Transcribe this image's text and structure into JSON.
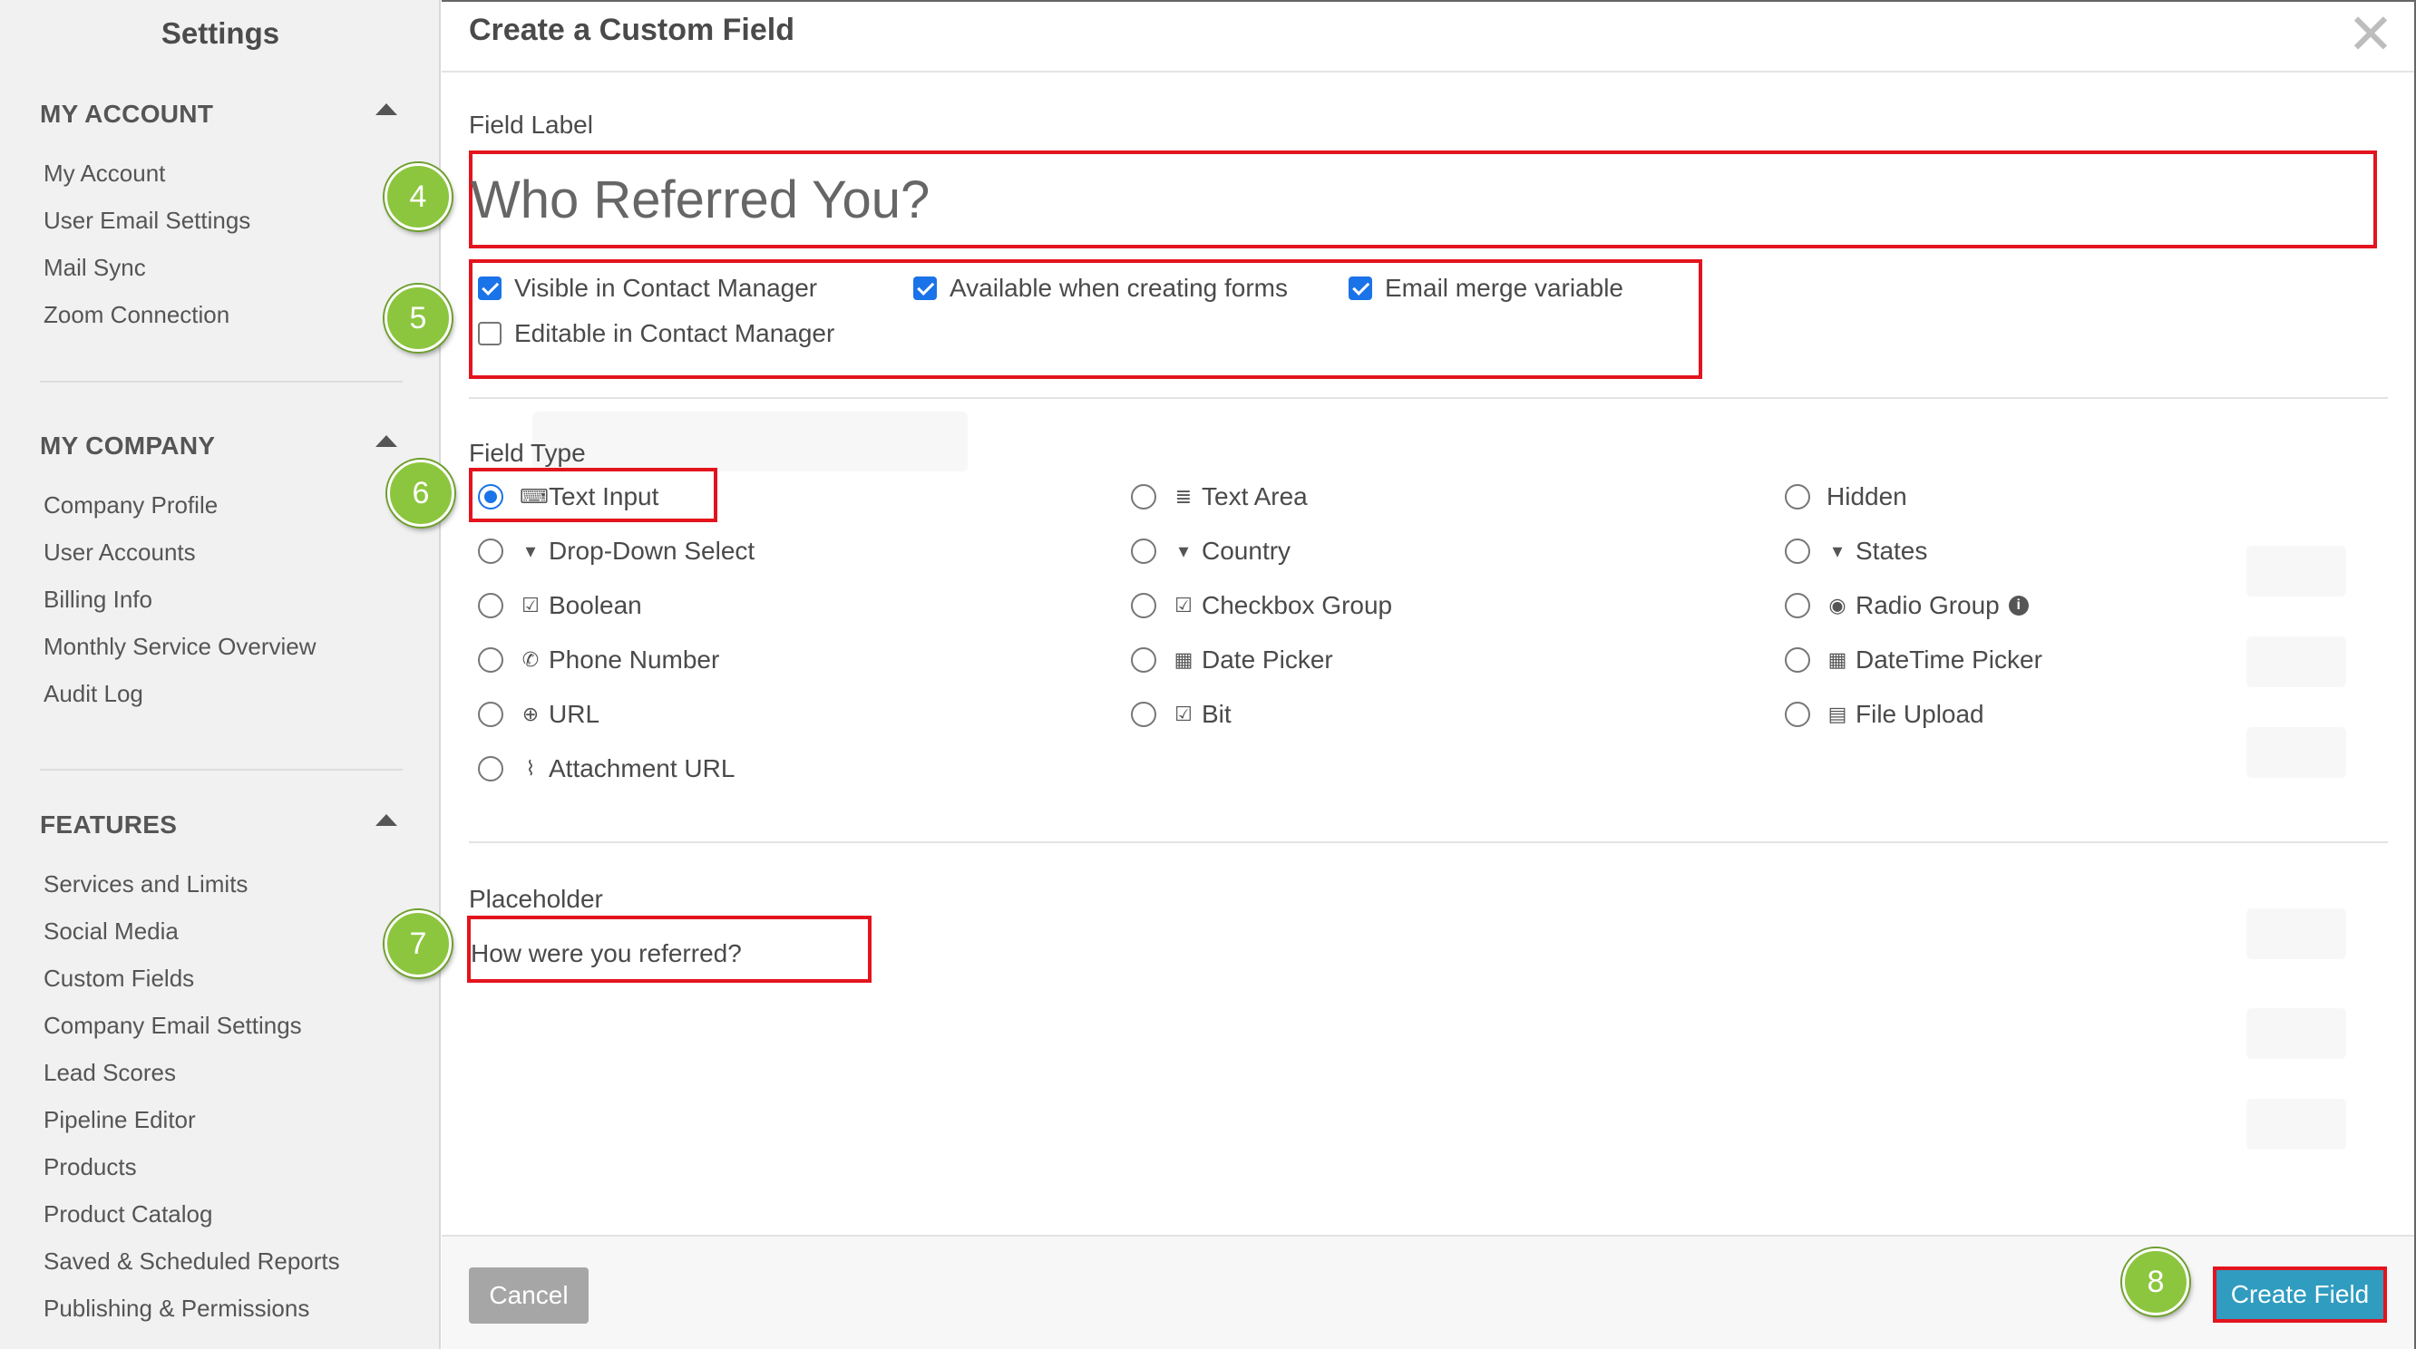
{
  "sidebar": {
    "title": "Settings",
    "sections": [
      {
        "title": "MY ACCOUNT",
        "items": [
          "My Account",
          "User Email Settings",
          "Mail Sync",
          "Zoom Connection"
        ]
      },
      {
        "title": "MY COMPANY",
        "items": [
          "Company Profile",
          "User Accounts",
          "Billing Info",
          "Monthly Service Overview",
          "Audit Log"
        ]
      },
      {
        "title": "FEATURES",
        "items": [
          "Services and Limits",
          "Social Media",
          "Custom Fields",
          "Company Email Settings",
          "Lead Scores",
          "Pipeline Editor",
          "Products",
          "Product Catalog",
          "Saved & Scheduled Reports",
          "Publishing & Permissions"
        ]
      }
    ]
  },
  "modal": {
    "title": "Create a Custom Field",
    "close_label": "✕",
    "field_label": {
      "label": "Field Label",
      "value": "Who Referred You?"
    },
    "options": [
      {
        "label": "Visible in Contact Manager",
        "checked": true
      },
      {
        "label": "Available when creating forms",
        "checked": true
      },
      {
        "label": "Email merge variable",
        "checked": true
      },
      {
        "label": "Editable in Contact Manager",
        "checked": false
      }
    ],
    "field_type": {
      "label": "Field Type",
      "selected": "Text Input",
      "columns": [
        [
          {
            "label": "Text Input",
            "icon": "text-input-icon",
            "glyph": "⌨"
          },
          {
            "label": "Drop-Down Select",
            "icon": "caret-square-down-icon",
            "glyph": "▾"
          },
          {
            "label": "Boolean",
            "icon": "check-square-icon",
            "glyph": "☑"
          },
          {
            "label": "Phone Number",
            "icon": "phone-icon",
            "glyph": "✆"
          },
          {
            "label": "URL",
            "icon": "globe-icon",
            "glyph": "⊕"
          },
          {
            "label": "Attachment URL",
            "icon": "paperclip-icon",
            "glyph": "⌇"
          }
        ],
        [
          {
            "label": "Text Area",
            "icon": "align-justify-icon",
            "glyph": "≣"
          },
          {
            "label": "Country",
            "icon": "caret-square-down-icon",
            "glyph": "▾"
          },
          {
            "label": "Checkbox Group",
            "icon": "check-square-icon",
            "glyph": "☑"
          },
          {
            "label": "Date Picker",
            "icon": "calendar-icon",
            "glyph": "▦"
          },
          {
            "label": "Bit",
            "icon": "check-square-icon",
            "glyph": "☑"
          }
        ],
        [
          {
            "label": "Hidden",
            "icon": "",
            "glyph": ""
          },
          {
            "label": "States",
            "icon": "caret-square-down-icon",
            "glyph": "▾"
          },
          {
            "label": "Radio Group",
            "icon": "dot-circle-icon",
            "glyph": "◉",
            "info": true
          },
          {
            "label": "DateTime Picker",
            "icon": "calendar-icon",
            "glyph": "▦"
          },
          {
            "label": "File Upload",
            "icon": "file-icon",
            "glyph": "▤"
          }
        ]
      ],
      "info_glyph": "i"
    },
    "placeholder": {
      "label": "Placeholder",
      "value": "How were you referred?"
    },
    "cancel_label": "Cancel",
    "create_label": "Create Field"
  },
  "badges": [
    "4",
    "5",
    "6",
    "7",
    "8"
  ],
  "colors": {
    "highlight_red": "#e3141d",
    "badge_green": "#8cc63f",
    "checkbox_blue": "#1a73e8",
    "create_button": "#2f9cc0",
    "cancel_button": "#a6a6a6"
  }
}
